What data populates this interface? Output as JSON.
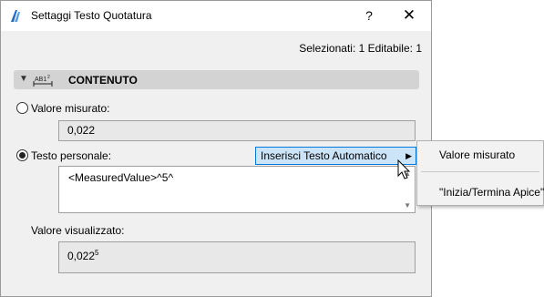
{
  "window": {
    "title": "Settaggi Testo Quotatura",
    "help_label": "?",
    "close_label": "✕"
  },
  "selection_info": "Selezionati: 1 Editabile: 1",
  "section": {
    "label": "CONTENUTO",
    "icon": "dimension-text-icon",
    "icon_text": "AB1",
    "icon_sup": "2"
  },
  "measured_value": {
    "label": "Valore misurato:",
    "value": "0,022",
    "selected": false
  },
  "custom_text": {
    "label": "Testo personale:",
    "value": "<MeasuredValue>^5^",
    "selected": true
  },
  "autotext_button": {
    "label": "Inserisci Testo Automatico"
  },
  "autotext_menu": {
    "items": [
      "Valore misurato",
      "\"Inizia/Termina Apice\""
    ]
  },
  "displayed_value": {
    "label": "Valore visualizzato:",
    "base": "0,022",
    "superscript": "5"
  },
  "colors": {
    "accent": "#0078d7",
    "button_hover": "#cce4f7",
    "section_bg": "#d3d3d3",
    "dialog_bg": "#f0f0f0"
  }
}
